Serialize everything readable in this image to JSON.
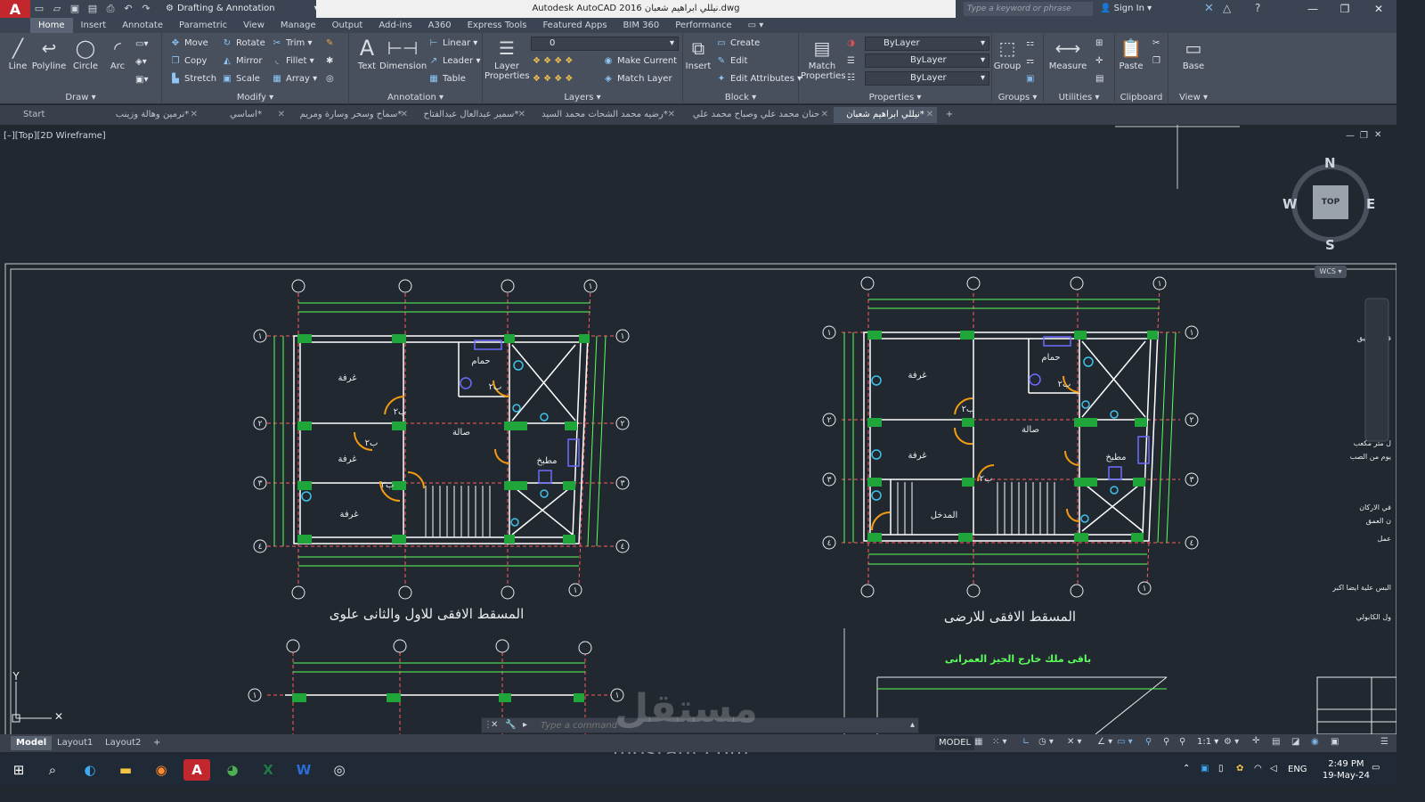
{
  "window": {
    "app_logo": "A",
    "workspace": "Drafting & Annotation",
    "title": "Autodesk AutoCAD 2016   نيللي ابراهيم شعبان.dwg",
    "search_placeholder": "Type a keyword or phrase",
    "sign_in": "Sign In"
  },
  "ribbon_tabs": [
    "Home",
    "Insert",
    "Annotate",
    "Parametric",
    "View",
    "Manage",
    "Output",
    "Add-ins",
    "A360",
    "Express Tools",
    "Featured Apps",
    "BIM 360",
    "Performance"
  ],
  "ribbon": {
    "draw": {
      "title": "Draw",
      "line": "Line",
      "polyline": "Polyline",
      "circle": "Circle",
      "arc": "Arc"
    },
    "modify": {
      "title": "Modify",
      "move": "Move",
      "rotate": "Rotate",
      "trim": "Trim",
      "copy": "Copy",
      "mirror": "Mirror",
      "fillet": "Fillet",
      "stretch": "Stretch",
      "scale": "Scale",
      "array": "Array"
    },
    "annotation": {
      "title": "Annotation",
      "text": "Text",
      "dimension": "Dimension",
      "linear": "Linear",
      "leader": "Leader",
      "table": "Table"
    },
    "layers": {
      "title": "Layers",
      "layer_properties": "Layer\nProperties",
      "layer_value": "0",
      "make_current": "Make Current",
      "match_layer": "Match Layer"
    },
    "block": {
      "title": "Block",
      "insert": "Insert",
      "create": "Create",
      "edit": "Edit",
      "edit_attributes": "Edit Attributes"
    },
    "properties": {
      "title": "Properties",
      "match_properties": "Match\nProperties",
      "color": "ByLayer",
      "linetype": "ByLayer",
      "lineweight": "ByLayer"
    },
    "groups": {
      "title": "Groups",
      "group": "Group"
    },
    "utilities": {
      "title": "Utilities",
      "measure": "Measure"
    },
    "clipboard": {
      "title": "Clipboard",
      "paste": "Paste"
    },
    "view": {
      "title": "View",
      "base": "Base"
    }
  },
  "doc_tabs": [
    {
      "label": "Start",
      "active": false
    },
    {
      "label": "نرمين وهالة وزينب*",
      "active": false
    },
    {
      "label": "اساسي*",
      "active": false
    },
    {
      "label": "سماح وسحر وسارة ومريم*",
      "active": false
    },
    {
      "label": "سمير عبدالعال عبدالفتاح*",
      "active": false
    },
    {
      "label": "رضيه محمد الشحات محمد السيد*",
      "active": false
    },
    {
      "label": "حنان محمد علي وصباح محمد علي",
      "active": false
    },
    {
      "label": "نيللي ابراهيم شعبان*",
      "active": true
    }
  ],
  "viewport_label": "[–][Top][2D Wireframe]",
  "navcube": {
    "n": "N",
    "s": "S",
    "e": "E",
    "w": "W",
    "top": "TOP",
    "wcs": "WCS"
  },
  "drawing": {
    "plan_upper_title": "المسقط الافقى للاول والثانى علوى",
    "plan_ground_title": "المسقط الافقى للارضى",
    "outside_zone_note": "باقى ملك خارج الحيز العمرانى",
    "room_bedroom": "غرفة",
    "room_hall": "صالة",
    "room_kitchen": "مطبخ",
    "room_bath": "حمام",
    "room_entrance": "المدخل",
    "door_label": "ب٢",
    "axis_labels": [
      "١",
      "٢",
      "٣",
      "٤"
    ],
    "notes_right": [
      "في التطبيق",
      "ل متر مكعب",
      "يوم من الصب",
      "في الاركان",
      "ن العمق",
      "عمل",
      "البس علية ايضا اكبر",
      "ول الكابولي"
    ]
  },
  "command_line": {
    "placeholder": "Type a command"
  },
  "layout_tabs": [
    "Model",
    "Layout1",
    "Layout2"
  ],
  "status": {
    "model": "MODEL",
    "scale": "1:1"
  },
  "taskbar": {
    "lang": "ENG",
    "time": "2:49 PM",
    "date": "19-May-24"
  },
  "watermark": "mostaql.com",
  "watermark_logo": "مستقل"
}
